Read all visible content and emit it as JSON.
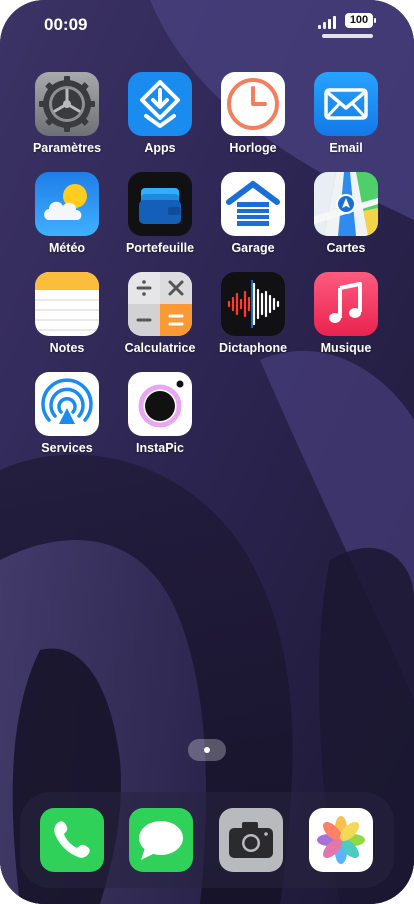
{
  "status": {
    "time": "00:09",
    "battery": "100"
  },
  "apps": [
    {
      "name": "Paramètres",
      "icon": "settings-gear-icon"
    },
    {
      "name": "Apps",
      "icon": "app-store-download-icon"
    },
    {
      "name": "Horloge",
      "icon": "clock-icon"
    },
    {
      "name": "Email",
      "icon": "mail-envelope-icon"
    },
    {
      "name": "Météo",
      "icon": "weather-sun-cloud-icon"
    },
    {
      "name": "Portefeuille",
      "icon": "wallet-cards-icon"
    },
    {
      "name": "Garage",
      "icon": "garage-house-icon"
    },
    {
      "name": "Cartes",
      "icon": "maps-icon"
    },
    {
      "name": "Notes",
      "icon": "notes-icon"
    },
    {
      "name": "Calculatrice",
      "icon": "calculator-icon"
    },
    {
      "name": "Dictaphone",
      "icon": "voice-memo-waveform-icon"
    },
    {
      "name": "Musique",
      "icon": "music-note-icon"
    },
    {
      "name": "Services",
      "icon": "airdrop-signal-icon"
    },
    {
      "name": "InstaPic",
      "icon": "camera-lens-icon"
    }
  ],
  "dock": [
    {
      "icon": "phone-handset-icon"
    },
    {
      "icon": "messages-bubble-icon"
    },
    {
      "icon": "camera-icon"
    },
    {
      "icon": "photos-flower-icon"
    }
  ],
  "colors": {
    "wallpaper_base": "#2a2346",
    "apps_blue": "#1a8cf0",
    "phone_green": "#2fd158",
    "clock_orange": "#f2805e"
  }
}
